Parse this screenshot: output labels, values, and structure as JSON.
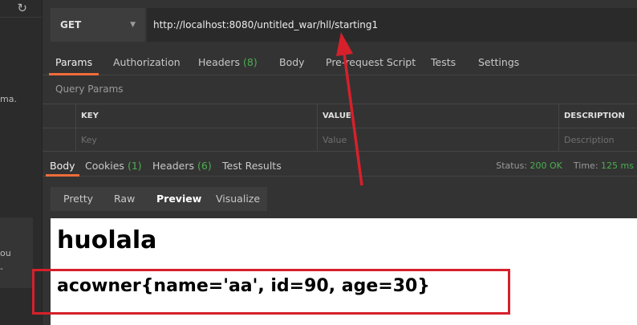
{
  "sidebar": {
    "refresh_icon": "refresh-icon",
    "frag_1": "ma.",
    "frag_2": "ou",
    "frag_3": "-"
  },
  "request": {
    "method": "GET",
    "url": "http://localhost:8080/untitled_war/hll/starting1"
  },
  "req_tabs": {
    "params": "Params",
    "authorization": "Authorization",
    "headers": "Headers",
    "headers_count": "(8)",
    "body": "Body",
    "prerequest": "Pre-request Script",
    "tests": "Tests",
    "settings": "Settings"
  },
  "query_params": {
    "title": "Query Params",
    "headers": [
      "KEY",
      "VALUE",
      "DESCRIPTION"
    ],
    "placeholders": [
      "Key",
      "Value",
      "Description"
    ]
  },
  "resp_tabs": {
    "body": "Body",
    "cookies": "Cookies",
    "cookies_count": "(1)",
    "headers": "Headers",
    "headers_count": "(6)",
    "test_results": "Test Results"
  },
  "status": {
    "status_label": "Status:",
    "status_value": "200 OK",
    "time_label": "Time:",
    "time_value": "125 ms"
  },
  "views": {
    "pretty": "Pretty",
    "raw": "Raw",
    "preview": "Preview",
    "visualize": "Visualize"
  },
  "preview": {
    "heading": "huolala",
    "line": "acowner{name='aa', id=90, age=30}"
  },
  "colors": {
    "accent": "#f26b3a",
    "success": "#4caf50",
    "annotation": "#d6202b"
  }
}
